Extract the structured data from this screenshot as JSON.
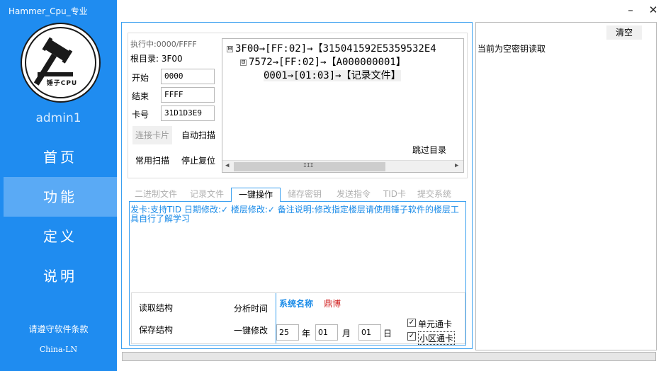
{
  "window": {
    "title": "Hammer_Cpu_专业",
    "minimize": "–",
    "close": "✕"
  },
  "sidebar": {
    "logo_text": "锤子CPU",
    "user": "admin1",
    "items": [
      {
        "label": "首页",
        "active": false
      },
      {
        "label": "功能",
        "active": true
      },
      {
        "label": "定义",
        "active": false
      },
      {
        "label": "说明",
        "active": false
      }
    ],
    "terms": "请遵守软件条款",
    "copyright": "China-LN"
  },
  "scan": {
    "executing": "执行中:0000/FFFF",
    "root": "根目录: 3F00",
    "start_label": "开始",
    "start_value": "0000",
    "end_label": "结束",
    "end_value": "FFFF",
    "card_label": "卡号",
    "card_value": "31D1D3E9",
    "btn_connect": "连接卡片",
    "btn_auto_scan": "自动扫描",
    "btn_common_scan": "常用扫描",
    "btn_stop_reset": "停止复位",
    "btn_skip_dir": "跳过目录"
  },
  "tree": {
    "nodes": [
      {
        "toggle": "⊟",
        "text": "3F00→[FF:02]→【315041592E5359532E4"
      },
      {
        "toggle": "⊟",
        "text": "7572→[FF:02]→【A000000001】"
      },
      {
        "toggle": "",
        "text": "0001→[01:03]→【记录文件】"
      }
    ],
    "scroll_left": "◀",
    "scroll_right": "▶",
    "scroll_grip": "III"
  },
  "tabs": [
    {
      "label": "二进制文件",
      "active": false
    },
    {
      "label": "记录文件",
      "active": false
    },
    {
      "label": "一键操作",
      "active": true
    },
    {
      "label": "储存密钥",
      "active": false
    },
    {
      "label": "发送指令",
      "active": false
    },
    {
      "label": "TID卡",
      "active": false
    },
    {
      "label": "提交系统",
      "active": false
    }
  ],
  "oneclick": {
    "note": "发卡:支持TID 日期修改:✓ 楼层修改:✓ 备注说明:修改指定楼层请使用锤子软件的楼层工具自行了解学习",
    "btn_read_struct": "读取结构",
    "btn_save_struct": "保存结构",
    "btn_analyze_time": "分析时间",
    "btn_one_modify": "一键修改",
    "system_label": "系统名称",
    "system_value": "鼎博",
    "year_value": "25",
    "year_unit": "年",
    "month_value": "01",
    "month_unit": "月",
    "day_value": "01",
    "day_unit": "日",
    "chk_unit": "单元通卡",
    "chk_area": "小区通卡",
    "checkmark": "✓"
  },
  "right": {
    "clear": "清空",
    "status": "当前为空密钥读取"
  },
  "colors": {
    "sidebar": "#1f8cf0",
    "active_nav": "#5aaaf5",
    "accent": "#3aa0f0",
    "note": "#1a8be8",
    "system_value": "#d02020"
  }
}
